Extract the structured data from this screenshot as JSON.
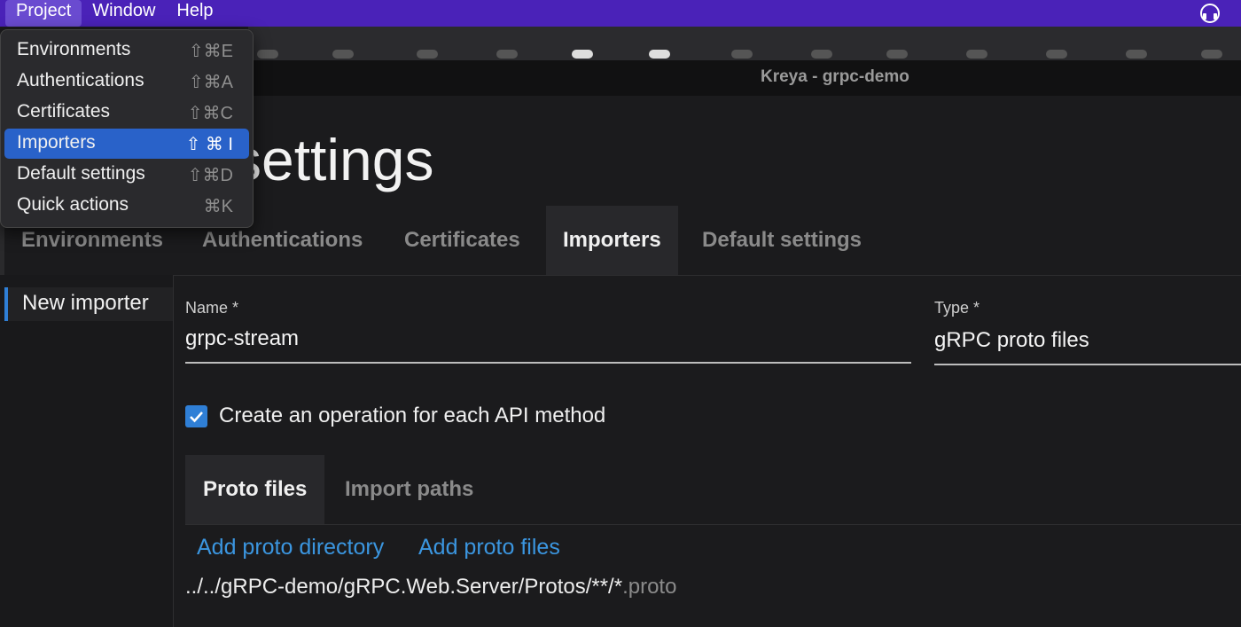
{
  "menubar": {
    "items": [
      "Project",
      "Window",
      "Help"
    ]
  },
  "window": {
    "title": "Kreya - grpc-demo"
  },
  "page": {
    "heading": "settings"
  },
  "settings_tabs": [
    "Environments",
    "Authentications",
    "Certificates",
    "Importers",
    "Default settings"
  ],
  "sidebar": {
    "items": [
      "New importer"
    ]
  },
  "form": {
    "name_label": "Name *",
    "name_value": "grpc-stream",
    "type_label": "Type *",
    "type_value": "gRPC proto files",
    "checkbox_label": "Create an operation for each API method",
    "checkbox_checked": true
  },
  "subtabs": [
    "Proto files",
    "Import paths"
  ],
  "actions": {
    "add_directory": "Add proto directory",
    "add_files": "Add proto files"
  },
  "proto_path": {
    "main": "../../gRPC-demo/gRPC.Web.Server/Protos/**/*",
    "ext": ".proto"
  },
  "project_menu": {
    "items": [
      {
        "label": "Environments",
        "shortcut": "⇧⌘E"
      },
      {
        "label": "Authentications",
        "shortcut": "⇧⌘A"
      },
      {
        "label": "Certificates",
        "shortcut": "⇧⌘C"
      },
      {
        "label": "Importers",
        "shortcut": "⇧ ⌘ I"
      },
      {
        "label": "Default settings",
        "shortcut": "⇧⌘D"
      },
      {
        "label": "Quick actions",
        "shortcut": "⌘K"
      }
    ]
  },
  "colors": {
    "menubar": "#4a22b8",
    "accent": "#2f7fd6",
    "link": "#3b96e0",
    "highlight": "#2962c9"
  }
}
